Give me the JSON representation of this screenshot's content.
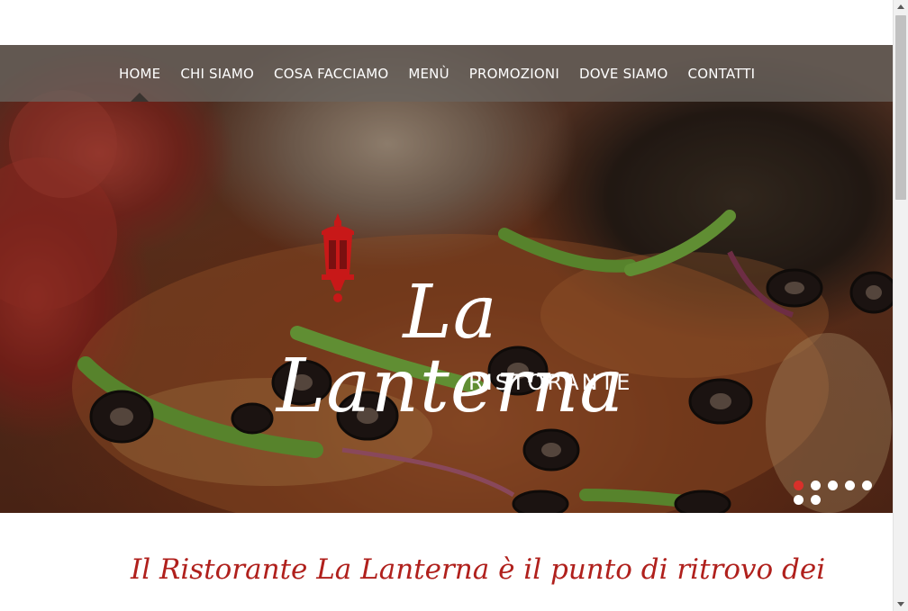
{
  "nav": {
    "items": [
      {
        "label": "HOME",
        "active": true
      },
      {
        "label": "CHI SIAMO"
      },
      {
        "label": "COSA FACCIAMO"
      },
      {
        "label": "MENÙ"
      },
      {
        "label": "PROMOZIONI"
      },
      {
        "label": "DOVE SIAMO"
      },
      {
        "label": "CONTATTI"
      }
    ]
  },
  "hero": {
    "logo_title": "La Lanterna",
    "logo_subtitle": "RISTORANTE",
    "logo_icon": "lantern-icon",
    "slide_count": 7,
    "active_slide": 1
  },
  "intro": {
    "line1": "Il Ristorante La Lanterna è il punto di ritrovo dei"
  },
  "colors": {
    "accent": "#b0201c",
    "nav_bg": "#69645f",
    "active_dot": "#d8302a"
  }
}
